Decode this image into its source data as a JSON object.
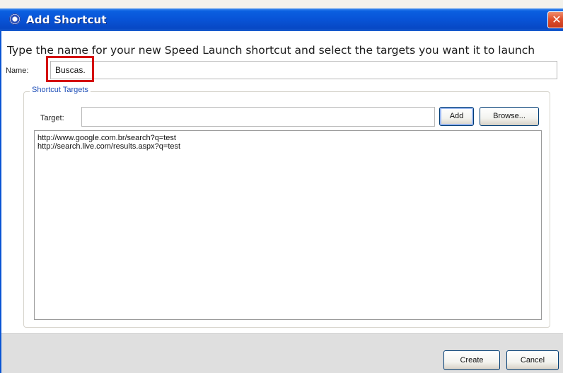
{
  "window": {
    "title": "Add Shortcut",
    "title_icon": "app-icon",
    "close_label": "✕"
  },
  "form": {
    "instruction": "Type the name for your new Speed Launch shortcut and select the targets you want it to launch",
    "name_label": "Name:",
    "name_value": "Buscas.",
    "group_title": "Shortcut Targets",
    "target_label": "Target:",
    "target_value": "",
    "add_label": "Add",
    "browse_label": "Browse...",
    "targets": [
      "http://www.google.com.br/search?q=test",
      "http://search.live.com/results.aspx?q=test"
    ]
  },
  "footer": {
    "create_label": "Create",
    "cancel_label": "Cancel"
  },
  "colors": {
    "titlebar": "#0853d6",
    "highlight": "#d40c0c",
    "close_button": "#e0502d",
    "group_title": "#1f4fb8"
  }
}
